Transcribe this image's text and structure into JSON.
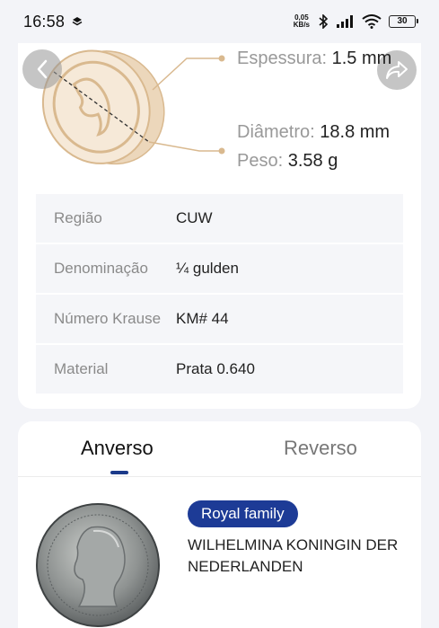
{
  "status_bar": {
    "time": "16:58",
    "net_speed_top": "0,05",
    "net_speed_unit": "KB/s",
    "battery": "30"
  },
  "specs": {
    "thickness_label": "Espessura:",
    "thickness_value": "1.5 mm",
    "diameter_label": "Diâmetro:",
    "diameter_value": "18.8 mm",
    "weight_label": "Peso:",
    "weight_value": "3.58 g"
  },
  "details": [
    {
      "label": "Região",
      "value": "CUW"
    },
    {
      "label": "Denominação",
      "value": "¼ gulden"
    },
    {
      "label": "Número Krause",
      "value": "KM# 44"
    },
    {
      "label": "Material",
      "value": "Prata 0.640"
    }
  ],
  "tabs": {
    "obverse": "Anverso",
    "reverse": "Reverso"
  },
  "obverse": {
    "badge": "Royal family",
    "inscription": "WILHELMINA KONINGIN DER NEDERLANDEN"
  },
  "colors": {
    "accent": "#1d3b96",
    "coin_outline": "#d9b98f",
    "coin_fill": "#f4e4cf"
  }
}
